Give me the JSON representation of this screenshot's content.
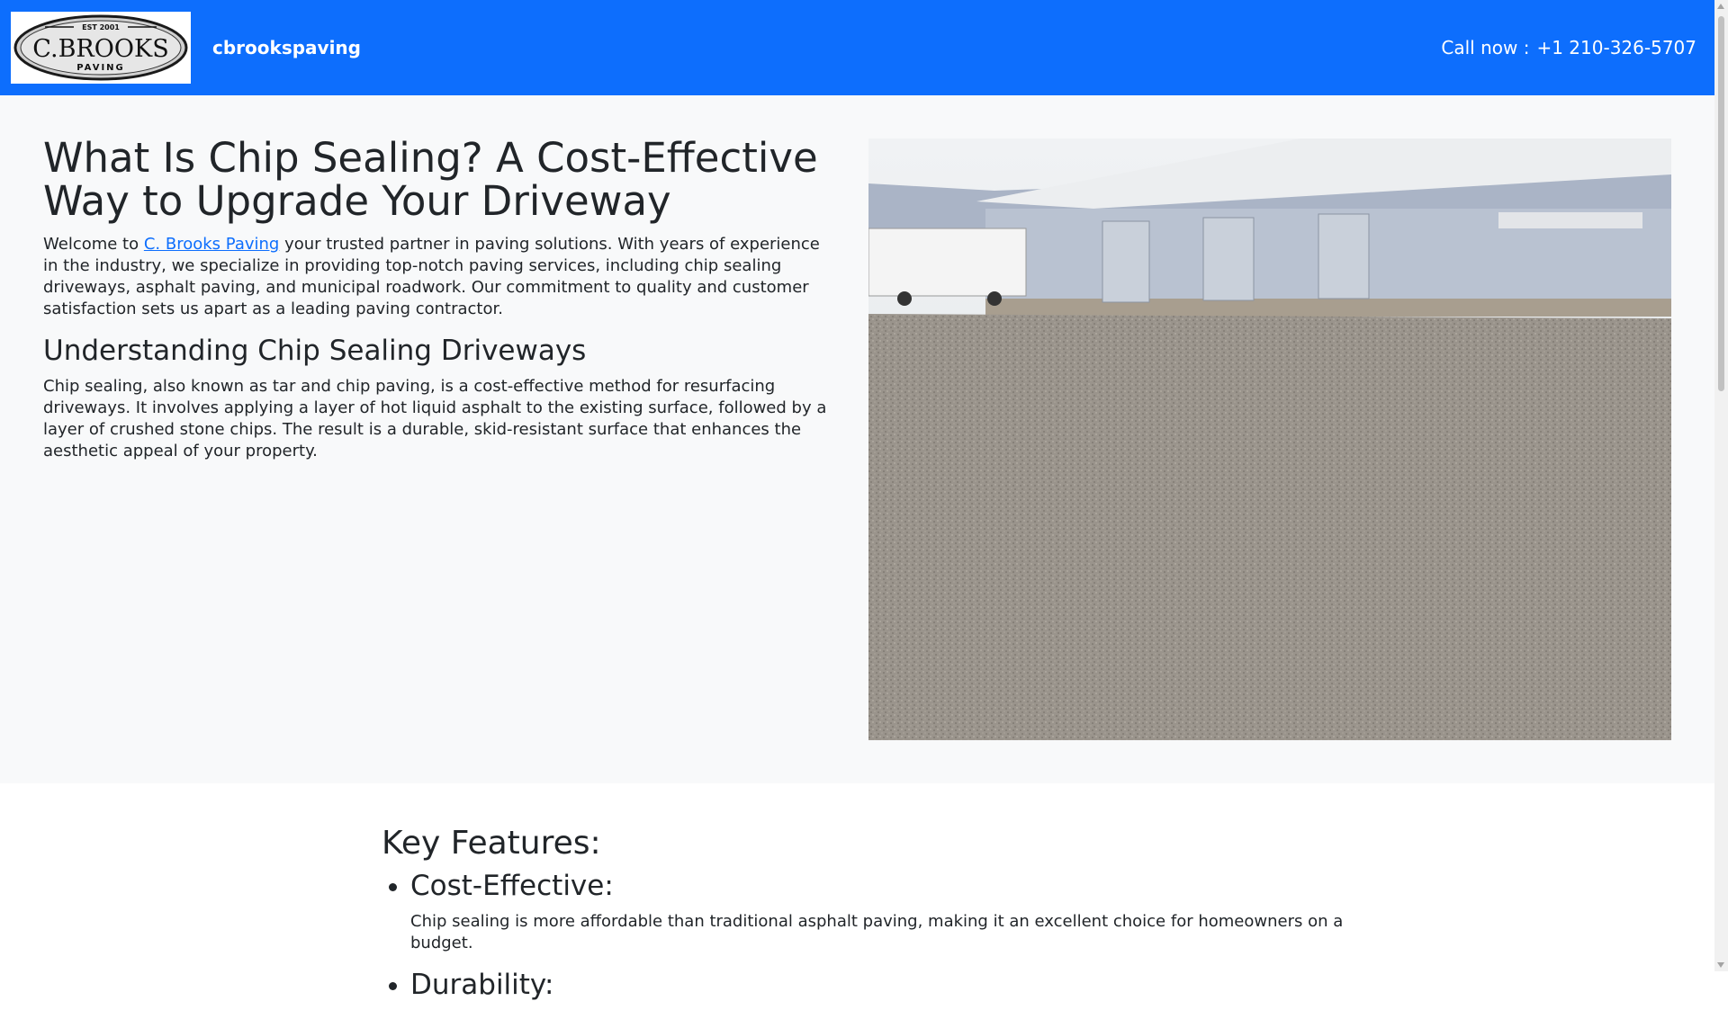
{
  "header": {
    "logo_top_text": "EST 2001",
    "logo_main_text": "C.BROOKS",
    "logo_sub_text": "PAVING",
    "brand_name": "cbrookspaving",
    "call_label": "Call now :",
    "phone": "+1 210-326-5707"
  },
  "hero": {
    "title": "What Is Chip Sealing? A Cost-Effective Way to Upgrade Your Driveway",
    "intro_before": "Welcome to ",
    "intro_link": "C. Brooks Paving",
    "intro_after": " your trusted partner in paving solutions. With years of experience in the industry, we specialize in providing top-notch paving services, including chip sealing driveways, asphalt paving, and municipal roadwork. Our commitment to quality and customer satisfaction sets us apart as a leading paving contractor.",
    "section_title": "Understanding Chip Sealing Driveways",
    "section_text": "Chip sealing, also known as tar and chip paving, is a cost-effective method for resurfacing driveways. It involves applying a layer of hot liquid asphalt to the existing surface, followed by a layer of crushed stone chips. The result is a durable, skid-resistant surface that enhances the aesthetic appeal of your property."
  },
  "features": {
    "title": "Key Features:",
    "items": [
      {
        "title": "Cost-Effective:",
        "text": "Chip sealing is more affordable than traditional asphalt paving, making it an excellent choice for homeowners on a budget."
      },
      {
        "title": "Durability:",
        "text": ""
      }
    ]
  },
  "colors": {
    "navbar": "#0d6efd",
    "hero_bg": "#f8f9fa",
    "link": "#0d6efd"
  }
}
